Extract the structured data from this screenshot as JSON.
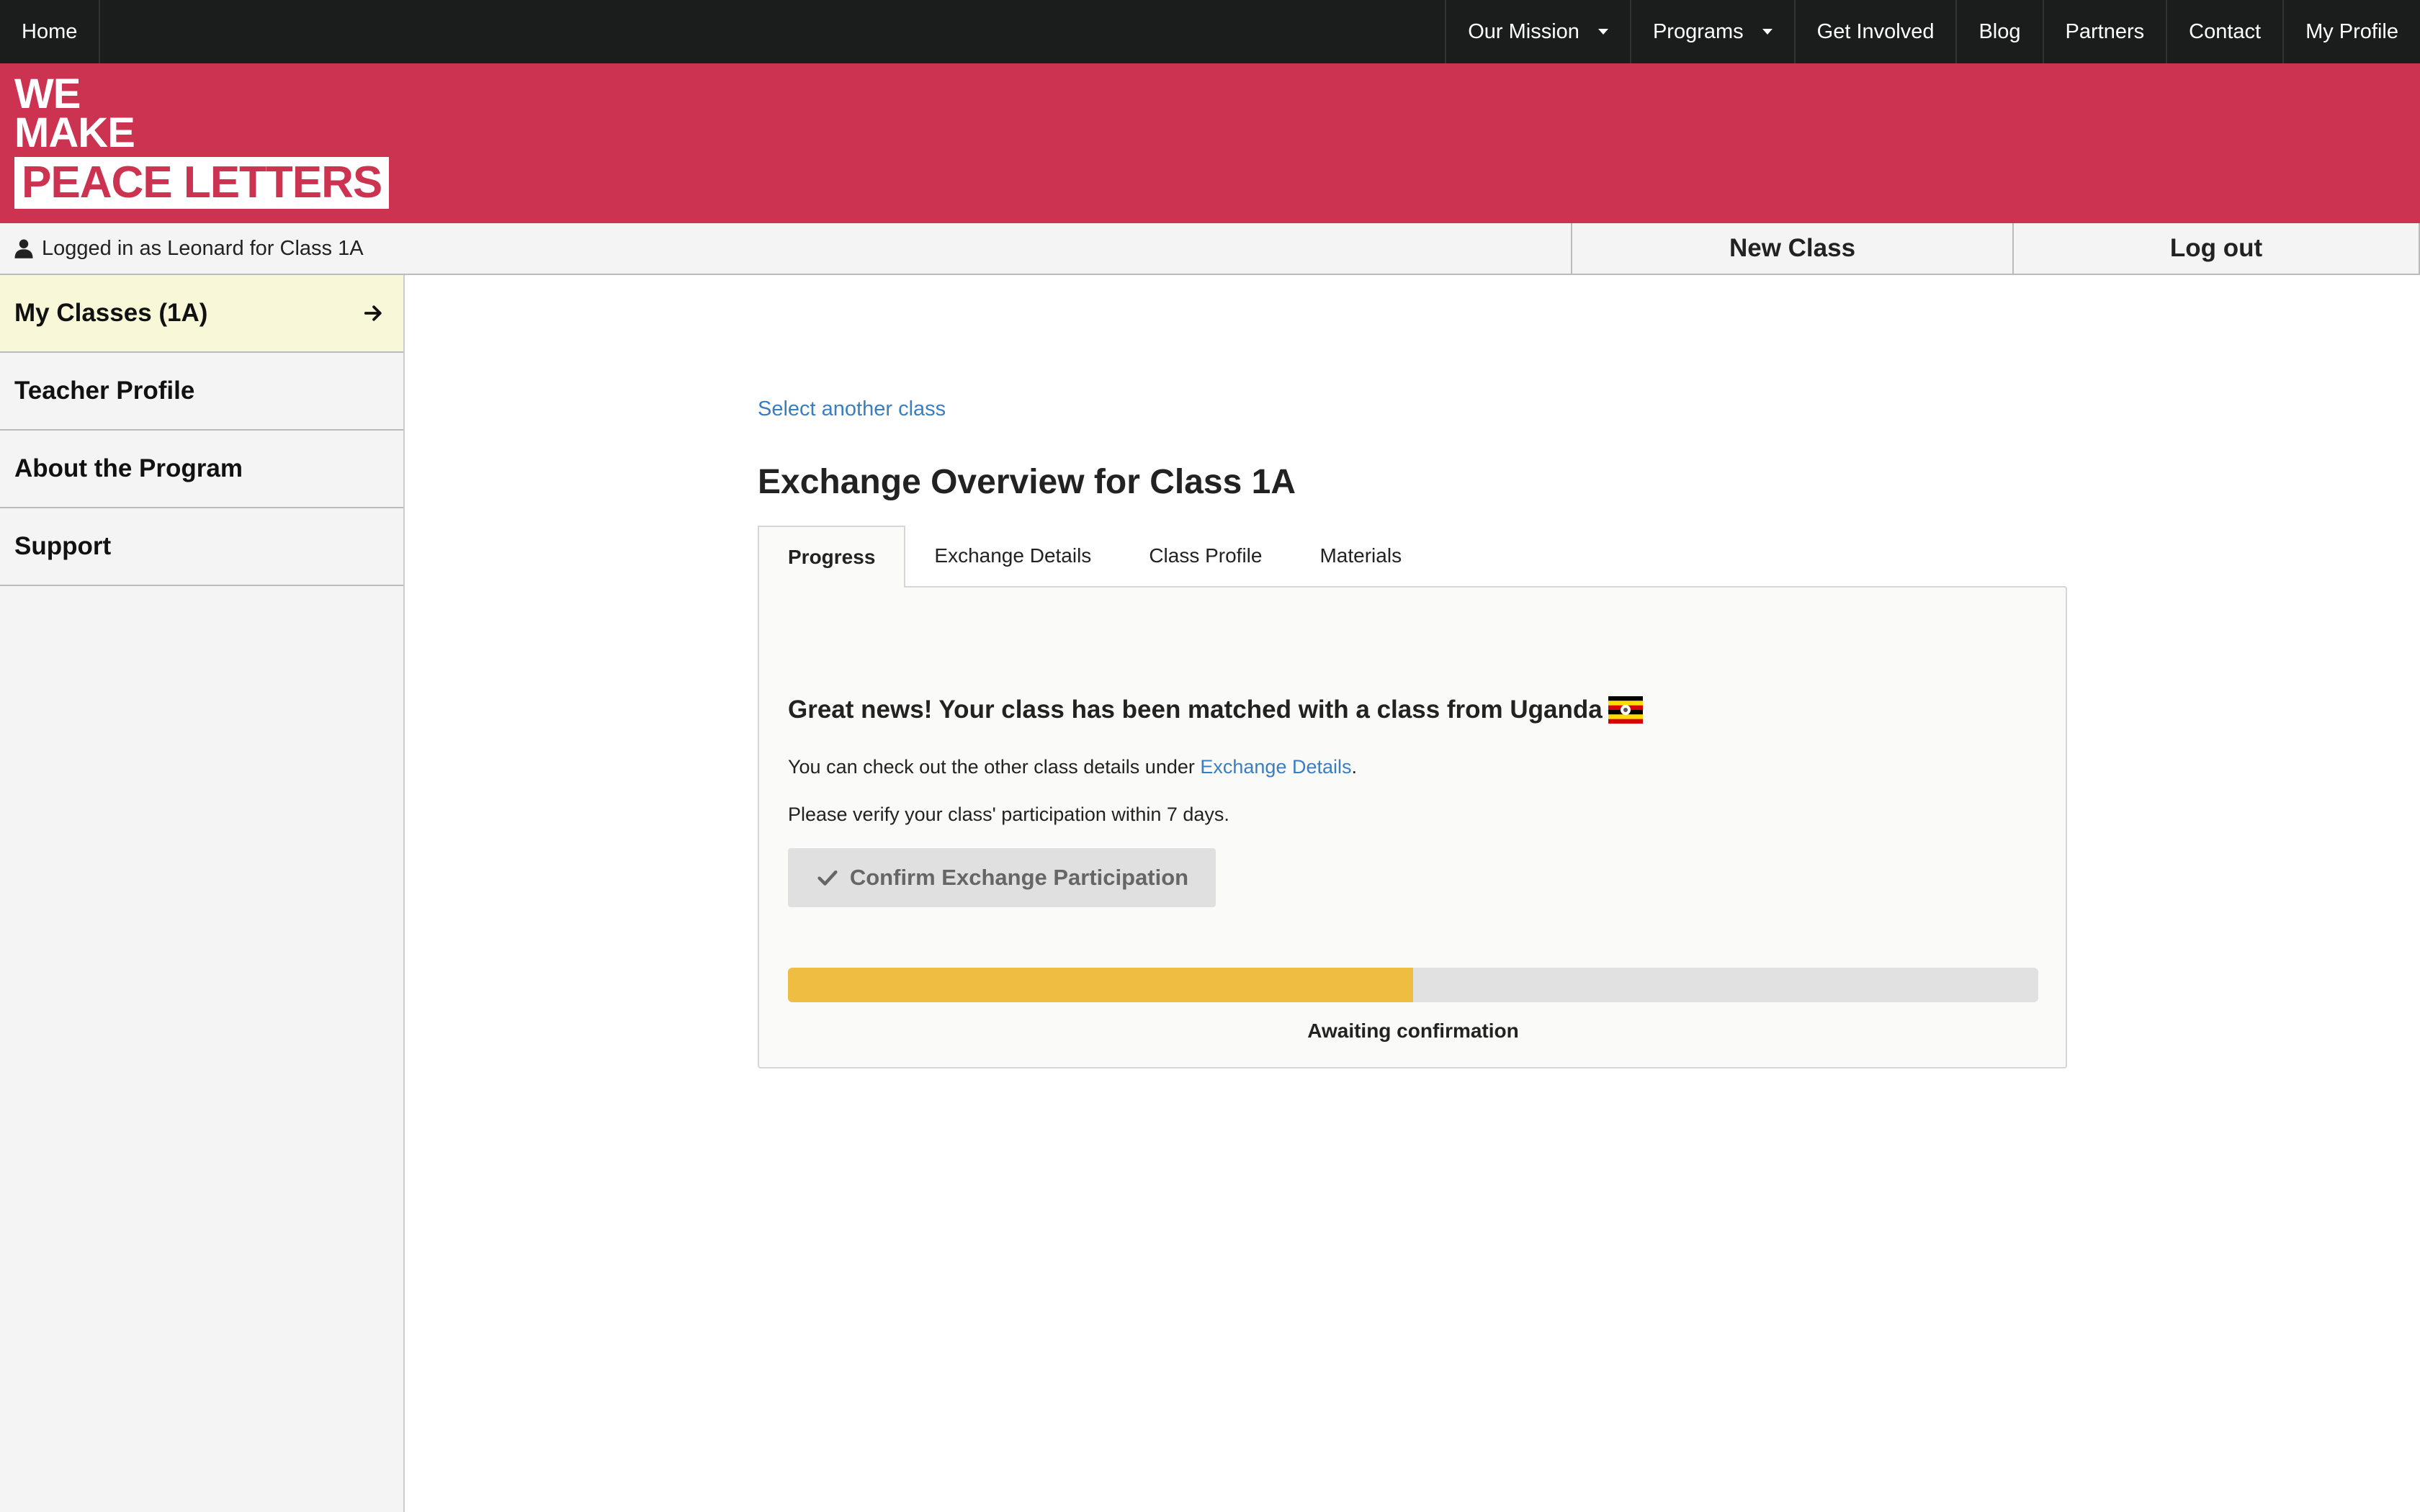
{
  "topnav": {
    "home": "Home",
    "items": [
      {
        "label": "Our Mission",
        "dropdown": true
      },
      {
        "label": "Programs",
        "dropdown": true
      },
      {
        "label": "Get Involved",
        "dropdown": false
      },
      {
        "label": "Blog",
        "dropdown": false
      },
      {
        "label": "Partners",
        "dropdown": false
      },
      {
        "label": "Contact",
        "dropdown": false
      },
      {
        "label": "My Profile",
        "dropdown": false
      }
    ]
  },
  "brand": {
    "line1": "WE",
    "line2": "MAKE",
    "line3": "PEACE LETTERS",
    "color": "#cc3351"
  },
  "status": {
    "logged_in_text": "Logged in as Leonard for Class 1A",
    "new_class": "New Class",
    "log_out": "Log out"
  },
  "sidebar": {
    "items": [
      {
        "label": "My Classes (1A)",
        "active": true
      },
      {
        "label": "Teacher Profile",
        "active": false
      },
      {
        "label": "About the Program",
        "active": false
      },
      {
        "label": "Support",
        "active": false
      }
    ]
  },
  "main": {
    "select_link": "Select another class",
    "title": "Exchange Overview for Class 1A",
    "tabs": [
      "Progress",
      "Exchange Details",
      "Class Profile",
      "Materials"
    ],
    "active_tab": "Progress",
    "match_heading": "Great news! Your class has been matched with a class from Uganda",
    "details_prefix": "You can check out the other class details under ",
    "details_link": "Exchange Details",
    "details_suffix": ".",
    "verify_text": "Please verify your class' participation within 7 days.",
    "confirm_button": "Confirm Exchange Participation",
    "progress_fraction": 0.5,
    "progress_label": "Awaiting confirmation"
  },
  "colors": {
    "accent": "#cc3351",
    "link": "#3a7ec2",
    "progress": "#f0bd43",
    "active_sidebar": "#f8f7d8"
  }
}
